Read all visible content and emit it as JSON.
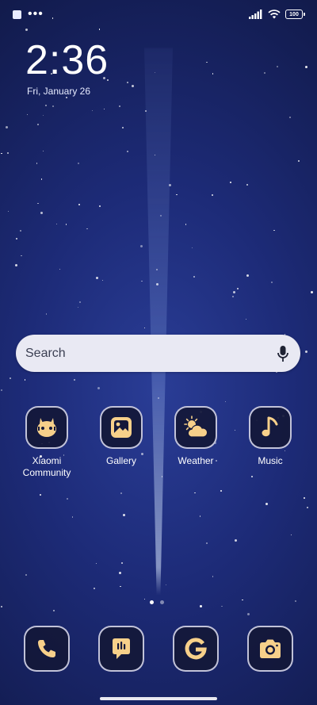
{
  "status_bar": {
    "battery": "100"
  },
  "clock": {
    "time": "2:36",
    "date": "Fri, January 26"
  },
  "search": {
    "placeholder": "Search"
  },
  "apps": [
    {
      "label": "Xiaomi Community",
      "icon": "xiaomi-community-icon"
    },
    {
      "label": "Gallery",
      "icon": "gallery-icon"
    },
    {
      "label": "Weather",
      "icon": "weather-icon"
    },
    {
      "label": "Music",
      "icon": "music-note-icon"
    }
  ],
  "dock": [
    {
      "name": "phone",
      "icon": "phone-icon"
    },
    {
      "name": "messages",
      "icon": "messages-icon"
    },
    {
      "name": "google",
      "icon": "google-icon"
    },
    {
      "name": "camera",
      "icon": "camera-icon"
    }
  ],
  "colors": {
    "icon_fill": "#f7d08a",
    "icon_bg": "#14183a",
    "search_bg": "#e9e9f3"
  }
}
